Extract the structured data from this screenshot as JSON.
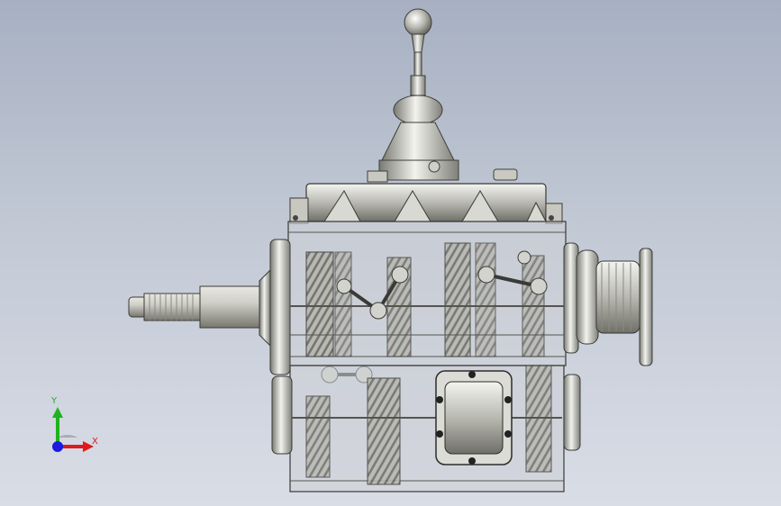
{
  "viewport": {
    "background_top": "#a7b0c2",
    "background_bottom": "#d9dde6"
  },
  "triad": {
    "x_label": "X",
    "y_label": "Y",
    "x_color": "#e01a1a",
    "y_color": "#1fb21f",
    "z_color": "#1a1ae0"
  },
  "model": {
    "subject": "gearbox-assembly"
  }
}
